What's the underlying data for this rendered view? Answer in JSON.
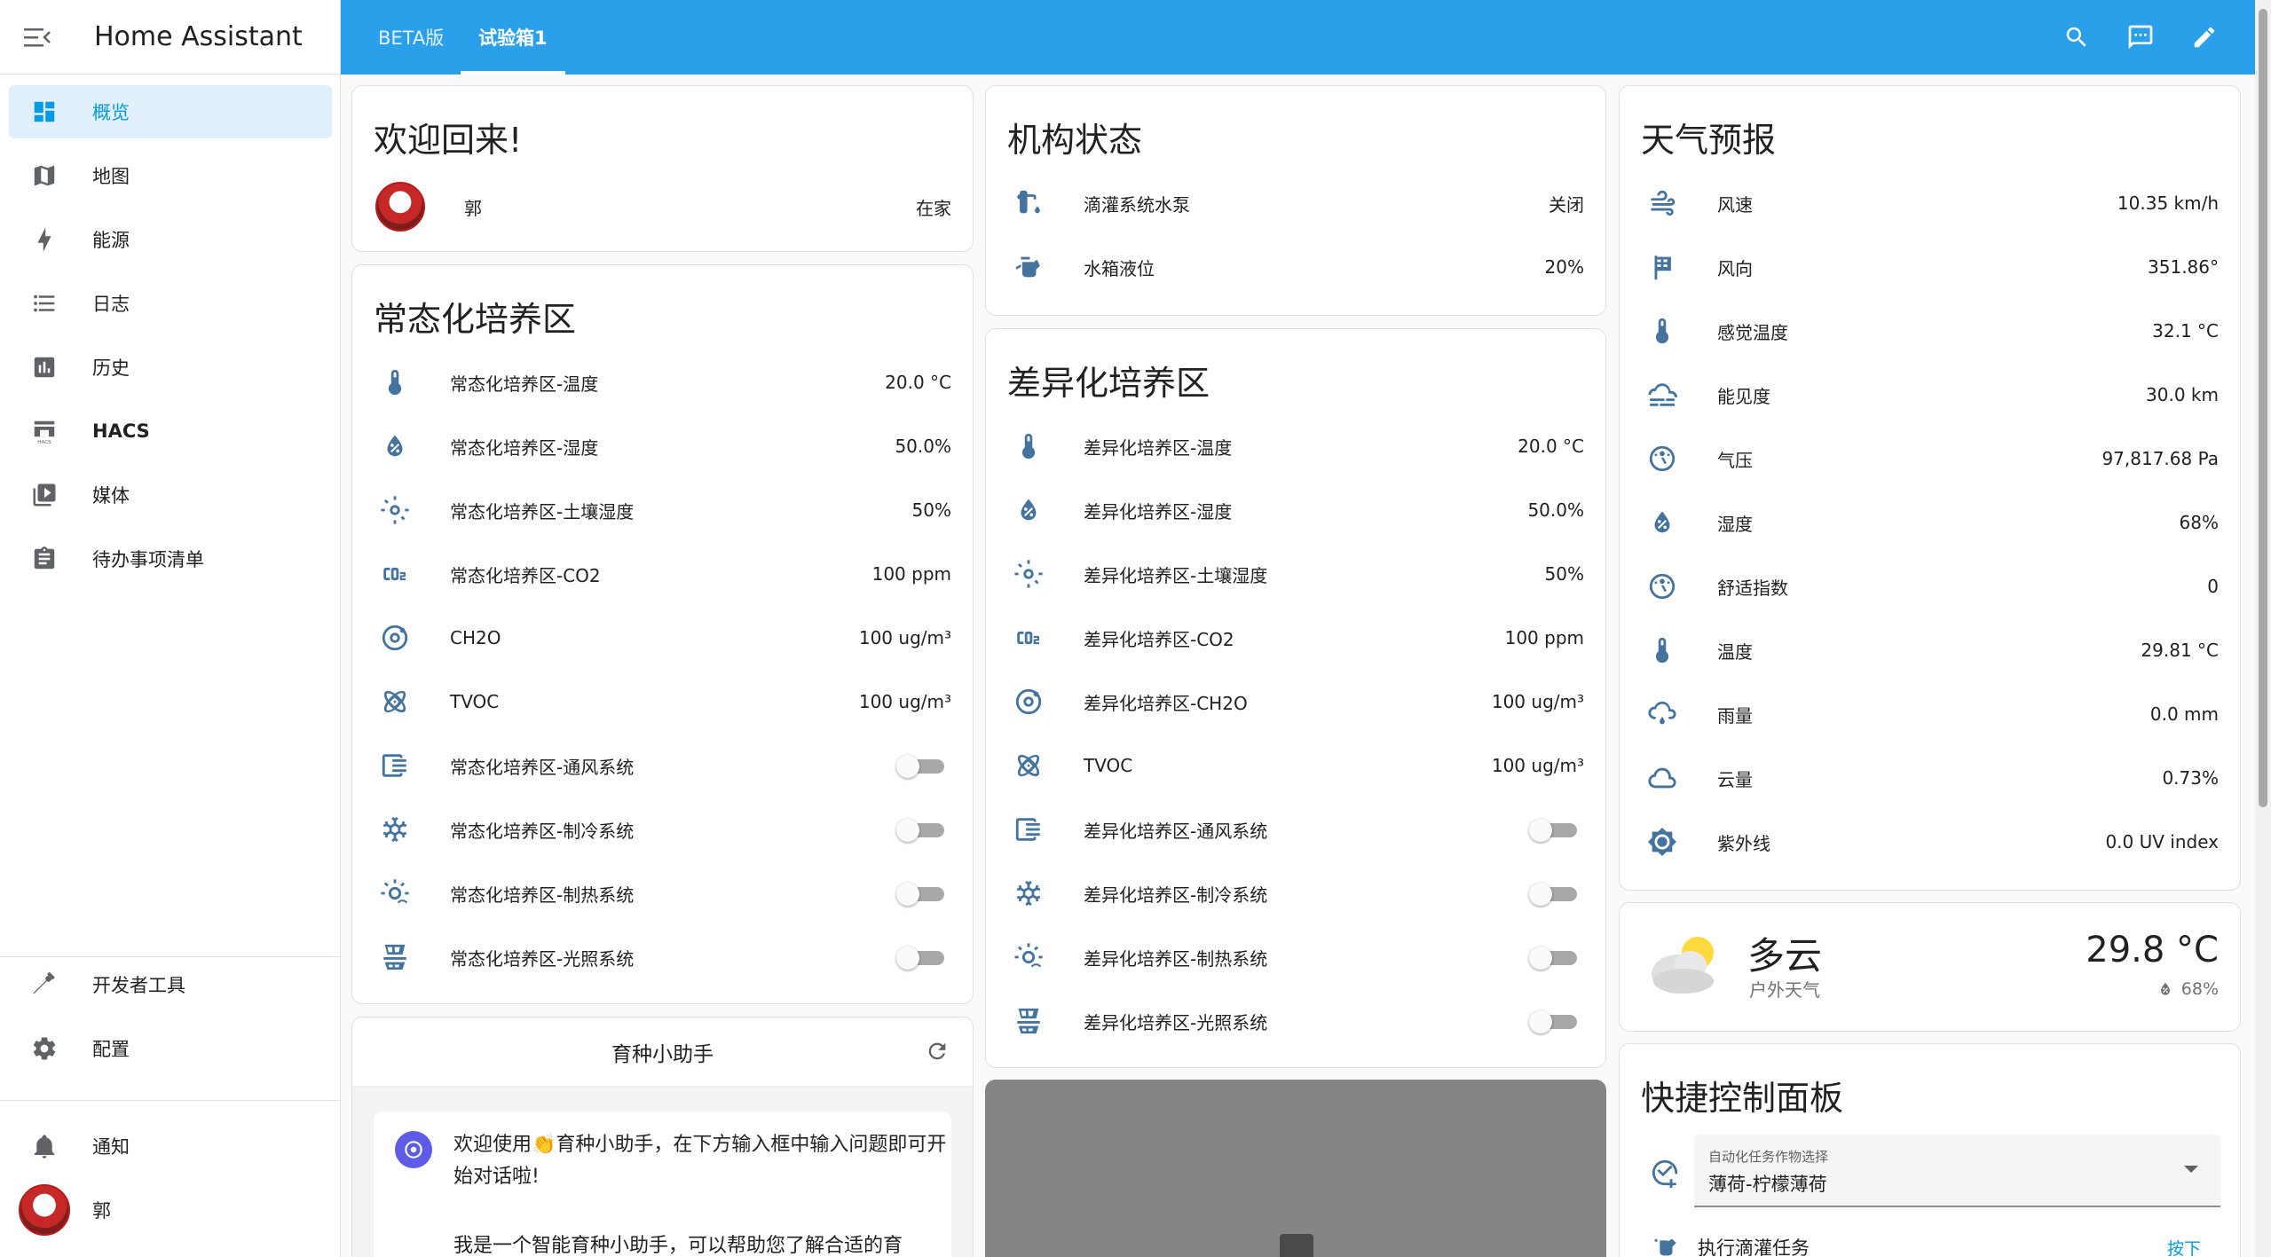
{
  "app": {
    "title": "Home Assistant"
  },
  "sidebar": {
    "items": [
      {
        "label": "概览",
        "icon": "dashboard-icon"
      },
      {
        "label": "地图",
        "icon": "map-icon"
      },
      {
        "label": "能源",
        "icon": "lightning-icon"
      },
      {
        "label": "日志",
        "icon": "list-icon"
      },
      {
        "label": "历史",
        "icon": "chart-icon"
      },
      {
        "label": "HACS",
        "icon": "hacs-icon"
      },
      {
        "label": "媒体",
        "icon": "media-icon"
      },
      {
        "label": "待办事项清单",
        "icon": "clipboard-icon"
      }
    ],
    "bottom_items": [
      {
        "label": "开发者工具",
        "icon": "hammer-icon"
      },
      {
        "label": "配置",
        "icon": "gear-icon"
      },
      {
        "label": "通知",
        "icon": "bell-icon"
      },
      {
        "label": "郭",
        "icon": "avatar"
      }
    ],
    "accent": "#039be5"
  },
  "topbar": {
    "tabs": [
      {
        "label": "BETA版"
      },
      {
        "label": "试验箱1"
      }
    ],
    "color": "#2aa0eb",
    "icons": [
      "search-icon",
      "assist-icon",
      "edit-icon"
    ]
  },
  "welcome": {
    "title": "欢迎回来!",
    "person": "郭",
    "state": "在家"
  },
  "mechanism": {
    "title": "机构状态",
    "rows": [
      {
        "name": "滴灌系统水泵",
        "value": "关闭",
        "icon": "water-pump-icon"
      },
      {
        "name": "水箱液位",
        "value": "20%",
        "icon": "watering-can-icon"
      }
    ]
  },
  "zone_normal": {
    "title": "常态化培养区",
    "rows": [
      {
        "name": "常态化培养区-温度",
        "value": "20.0 °C",
        "icon": "thermometer-icon"
      },
      {
        "name": "常态化培养区-湿度",
        "value": "50.0%",
        "icon": "humidity-icon"
      },
      {
        "name": "常态化培养区-土壤湿度",
        "value": "50%",
        "icon": "soil-moisture-icon"
      },
      {
        "name": "常态化培养区-CO2",
        "value": "100 ppm",
        "icon": "co2-icon"
      },
      {
        "name": "CH2O",
        "value": "100 ug/m³",
        "icon": "molecule-icon"
      },
      {
        "name": "TVOC",
        "value": "100 ug/m³",
        "icon": "atom-icon"
      }
    ],
    "switches": [
      {
        "name": "常态化培养区-通风系统",
        "icon": "ventilation-icon",
        "state": "off"
      },
      {
        "name": "常态化培养区-制冷系统",
        "icon": "snowflake-icon",
        "state": "off"
      },
      {
        "name": "常态化培养区-制热系统",
        "icon": "heat-icon",
        "state": "off"
      },
      {
        "name": "常态化培养区-光照系统",
        "icon": "solar-panel-icon",
        "state": "off"
      }
    ]
  },
  "zone_diff": {
    "title": "差异化培养区",
    "rows": [
      {
        "name": "差异化培养区-温度",
        "value": "20.0 °C",
        "icon": "thermometer-icon"
      },
      {
        "name": "差异化培养区-湿度",
        "value": "50.0%",
        "icon": "humidity-icon"
      },
      {
        "name": "差异化培养区-土壤湿度",
        "value": "50%",
        "icon": "soil-moisture-icon"
      },
      {
        "name": "差异化培养区-CO2",
        "value": "100 ppm",
        "icon": "co2-icon"
      },
      {
        "name": "差异化培养区-CH2O",
        "value": "100 ug/m³",
        "icon": "molecule-icon"
      },
      {
        "name": "TVOC",
        "value": "100 ug/m³",
        "icon": "atom-icon"
      }
    ],
    "switches": [
      {
        "name": "差异化培养区-通风系统",
        "icon": "ventilation-icon",
        "state": "off"
      },
      {
        "name": "差异化培养区-制冷系统",
        "icon": "snowflake-icon",
        "state": "off"
      },
      {
        "name": "差异化培养区-制热系统",
        "icon": "heat-icon",
        "state": "off"
      },
      {
        "name": "差异化培养区-光照系统",
        "icon": "solar-panel-icon",
        "state": "off"
      }
    ]
  },
  "weather": {
    "title": "天气预报",
    "rows": [
      {
        "name": "风速",
        "value": "10.35 km/h",
        "icon": "wind-icon"
      },
      {
        "name": "风向",
        "value": "351.86°",
        "icon": "windsock-icon"
      },
      {
        "name": "感觉温度",
        "value": "32.1 °C",
        "icon": "thermometer-icon"
      },
      {
        "name": "能见度",
        "value": "30.0 km",
        "icon": "fog-icon"
      },
      {
        "name": "气压",
        "value": "97,817.68 Pa",
        "icon": "gauge-icon"
      },
      {
        "name": "湿度",
        "value": "68%",
        "icon": "humidity-icon"
      },
      {
        "name": "舒适指数",
        "value": "0",
        "icon": "gauge-icon"
      },
      {
        "name": "温度",
        "value": "29.81 °C",
        "icon": "thermometer-icon"
      },
      {
        "name": "雨量",
        "value": "0.0 mm",
        "icon": "rain-icon"
      },
      {
        "name": "云量",
        "value": "0.73%",
        "icon": "cloud-icon"
      },
      {
        "name": "紫外线",
        "value": "0.0 UV index",
        "icon": "sun-icon"
      }
    ]
  },
  "weather_now": {
    "condition": "多云",
    "subtitle": "户外天气",
    "temp": "29.8 °C",
    "humidity": "68%"
  },
  "assistant": {
    "title": "育种小助手",
    "message1": "欢迎使用👏育种小助手，在下方输入框中输入问题即可开始对话啦!",
    "message2": "我是一个智能育种小助手，可以帮助您了解合适的育"
  },
  "quick_panel": {
    "title": "快捷控制面板",
    "select_label": "自动化任务作物选择",
    "select_value": "薄荷-柠檬薄荷",
    "action_name": "执行滴灌任务",
    "action_button": "按下"
  },
  "colors": {
    "icon": "#44739e",
    "icon_grey": "#5f6368"
  }
}
